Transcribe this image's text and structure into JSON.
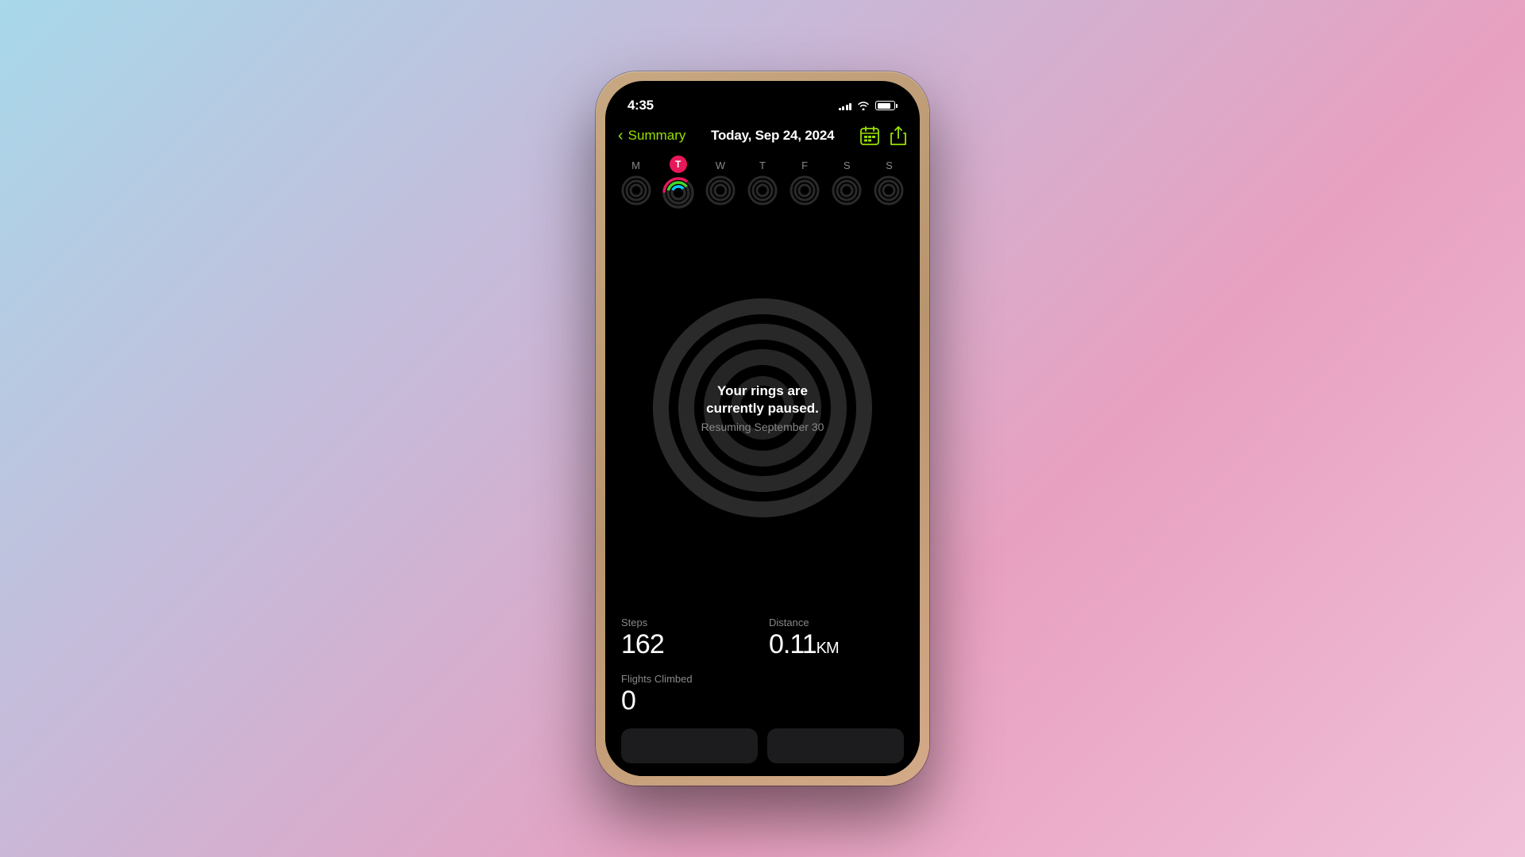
{
  "background": {
    "gradient": "linear-gradient(135deg, #a8d8ea, #c9b8d8, #e8a0c0)"
  },
  "phone": {
    "status_bar": {
      "time": "4:35",
      "signal_bars": [
        3,
        5,
        7,
        9,
        11
      ],
      "battery_level": 80
    },
    "nav": {
      "back_label": "Summary",
      "title": "Today, Sep 24, 2024",
      "calendar_icon": "calendar-icon",
      "share_icon": "share-icon"
    },
    "days": [
      {
        "letter": "M",
        "active": false,
        "is_today": false
      },
      {
        "letter": "T",
        "active": true,
        "is_today": true
      },
      {
        "letter": "W",
        "active": false,
        "is_today": false
      },
      {
        "letter": "T",
        "active": false,
        "is_today": false
      },
      {
        "letter": "F",
        "active": false,
        "is_today": false
      },
      {
        "letter": "S",
        "active": false,
        "is_today": false
      },
      {
        "letter": "S",
        "active": false,
        "is_today": false
      }
    ],
    "rings": {
      "paused_title": "Your rings are\ncurrently paused.",
      "paused_title_line1": "Your rings are",
      "paused_title_line2": "currently paused.",
      "resuming_text": "Resuming September 30"
    },
    "stats": [
      {
        "label": "Steps",
        "value": "162",
        "unit": ""
      },
      {
        "label": "Distance",
        "value": "0.11",
        "unit": "KM"
      }
    ],
    "flights": {
      "label": "Flights Climbed",
      "value": "0"
    }
  }
}
